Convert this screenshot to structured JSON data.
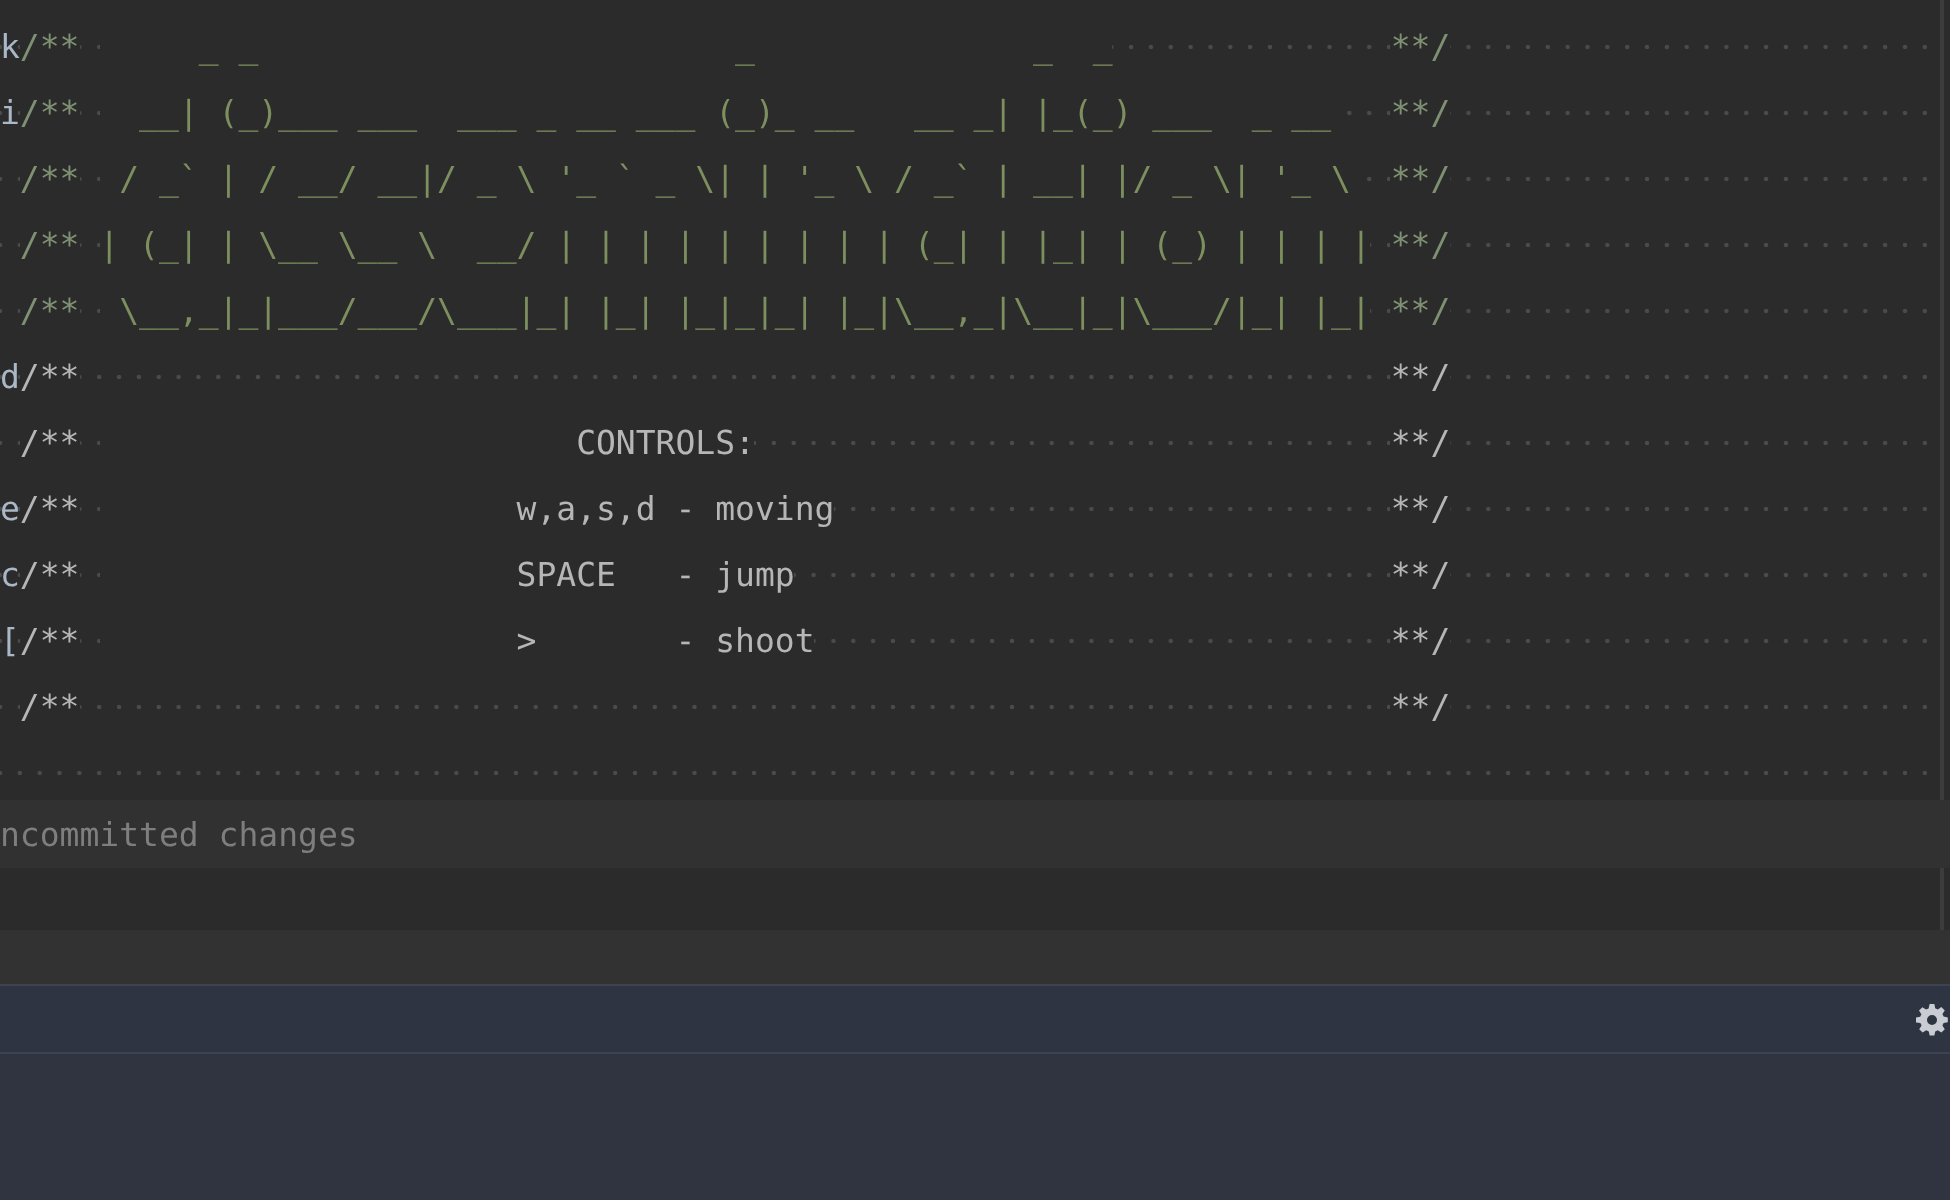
{
  "editor": {
    "lines": [
      {
        "kind": "art",
        "gutter": "k",
        "open": "/**",
        "text": "     _ _                        _              _  _",
        "close": "**/"
      },
      {
        "kind": "art",
        "gutter": "i",
        "open": "/**",
        "text": "  __| (_)___ ___  ___ _ __ ___ (_)_ __   __ _| |_(_) ___  _ __",
        "close": "**/"
      },
      {
        "kind": "art",
        "open": "/**",
        "text": " / _` | / __/ __|/ _ \\ '_ ` _ \\| | '_ \\ / _` | __| |/ _ \\| '_ \\",
        "close": "**/"
      },
      {
        "kind": "art",
        "open": "/**",
        "text": "| (_| | \\__ \\__ \\  __/ | | | | | | | | | (_| | |_| | (_) | | | |",
        "close": "**/"
      },
      {
        "kind": "art",
        "open": "/**",
        "text": " \\__,_|_|___/___/\\___|_| |_| |_|_|_| |_|\\__,_|\\__|_|\\___/|_| |_|",
        "close": "**/"
      },
      {
        "kind": "text",
        "gutter": "d",
        "open": "/**",
        "close": "**/"
      },
      {
        "kind": "text",
        "open": "/**",
        "text": "                        CONTROLS:",
        "close": "**/"
      },
      {
        "kind": "text",
        "gutter": "e",
        "open": "/**",
        "text": "                     w,a,s,d - moving",
        "close": "**/"
      },
      {
        "kind": "text",
        "gutter": "c",
        "open": "/**",
        "text": "                     SPACE   - jump",
        "close": "**/"
      },
      {
        "kind": "text",
        "gutter": "[",
        "open": "/**",
        "text": "                     >       - shoot",
        "close": "**/"
      },
      {
        "kind": "text",
        "open": "/**",
        "close": "**/"
      }
    ]
  },
  "status": {
    "text": "ncommitted changes"
  }
}
